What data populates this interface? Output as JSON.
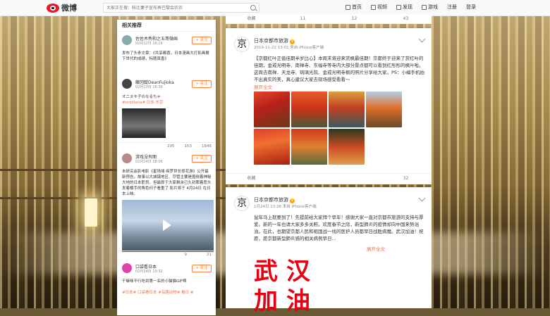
{
  "nav": {
    "logo": "微博",
    "search_placeholder": "大家正在搜：科比妻子宣布再巴黎会农农",
    "items": [
      "首页",
      "视频",
      "发现",
      "游戏",
      "注册",
      "登录"
    ]
  },
  "top_strip": {
    "collect": "收藏",
    "share": "11",
    "comment": "12",
    "like": "43"
  },
  "sidebar": {
    "title": "相关推荐",
    "follow_label": "+ 关注",
    "posts": [
      {
        "name": "佐佐木秀和之五哥微画",
        "time": "02月12日 16:19",
        "text": "发布了头条文章：《共享都喜，日本漫画大灯影画展下世代的成绩，标题真香》",
        "link": "共享都喜，日本漫画大灯影画展下世代的成绩"
      },
      {
        "name": "藤冈靛DeanFujioka",
        "time": "02月13日 16:36",
        "text": "オニヌキ子のなるちゃ",
        "tags": "#ordillena# 日本·东京",
        "repost": "295",
        "comment": "163",
        "like": "1846"
      },
      {
        "name": "游戏没有图",
        "time": "02月14日 18:06",
        "text": "未研买会影电影《星场域·疾罗世长修花游》公开最新预告，故事以大城镇地区、尽管主要是围绕着神秘大地的日本职员，但最即于大家剩余已久封罪着恶头发着樱手的角色何子看重了 影片将于 4月24日 在日本上映。",
        "repost": "9",
        "comment": "",
        "like": "21"
      },
      {
        "name": "口袋看日本",
        "time": "02月14日 10:32",
        "text": "干嘛咪不行吃到第一名的小猫猫GIF啊",
        "tags": "#日本# 口袋看日本 #有趣动物# 看日 #"
      }
    ]
  },
  "cards": [
    {
      "name": "日本京都市旅游",
      "time": "2019-11-22 13:01 来自 iPhone客户端",
      "text": "【京都红叶正值佳期半岁比心】本周末将迎来赏枫最佳期！京都终于迎来了赏红叶的佳期，金戒光明寺、南禅寺、东福寺等寺内大部分景点都可以看到红彤彤的枫叶啦。这周去南禅、天龙寺、琉璃光院、金戒光明寺枫的照片分享给大家。PS：小编手机拍不出真实的美，真心建议大家去现场感受看看～",
      "more": "展开全文",
      "collect": "收藏",
      "repost": "",
      "comment": "",
      "like": "32"
    },
    {
      "name": "日本京都市旅游",
      "time": "1月24日 13:26 来自 iPhone客户端",
      "text": "鼠年马上就要到了！先提前给大家拜个早年！感谢大家一直对京都市旅游的支持与厚爱。新的一年也请大家多多关照。欢度春节之际，新型肺炎的疫情却向中国来势汹汹。在此，也期望京都人民和祖国战一线的医护人员都早日战胜病魔。武汉加油！祝愿，愿京都新型肺炎感的相关病例早日...",
      "more": "展开全文",
      "poster": [
        "武",
        "汉",
        "加",
        "油"
      ]
    }
  ]
}
